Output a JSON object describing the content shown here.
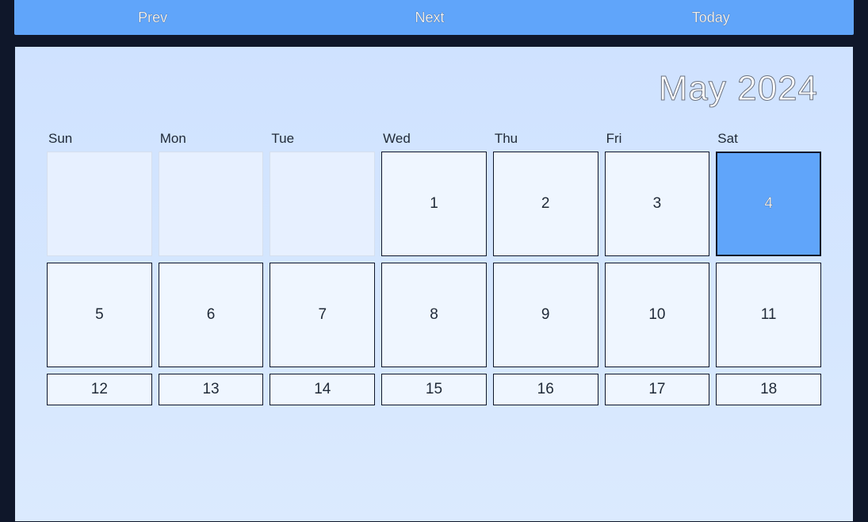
{
  "nav": {
    "prev": "Prev",
    "next": "Next",
    "today": "Today"
  },
  "title": "May 2024",
  "weekdays": [
    "Sun",
    "Mon",
    "Tue",
    "Wed",
    "Thu",
    "Fri",
    "Sat"
  ],
  "weeks": [
    [
      {
        "day": "",
        "outside": true,
        "selected": false
      },
      {
        "day": "",
        "outside": true,
        "selected": false
      },
      {
        "day": "",
        "outside": true,
        "selected": false
      },
      {
        "day": "1",
        "outside": false,
        "selected": false
      },
      {
        "day": "2",
        "outside": false,
        "selected": false
      },
      {
        "day": "3",
        "outside": false,
        "selected": false
      },
      {
        "day": "4",
        "outside": false,
        "selected": true
      }
    ],
    [
      {
        "day": "5",
        "outside": false,
        "selected": false
      },
      {
        "day": "6",
        "outside": false,
        "selected": false
      },
      {
        "day": "7",
        "outside": false,
        "selected": false
      },
      {
        "day": "8",
        "outside": false,
        "selected": false
      },
      {
        "day": "9",
        "outside": false,
        "selected": false
      },
      {
        "day": "10",
        "outside": false,
        "selected": false
      },
      {
        "day": "11",
        "outside": false,
        "selected": false
      }
    ],
    [
      {
        "day": "12",
        "outside": false,
        "selected": false
      },
      {
        "day": "13",
        "outside": false,
        "selected": false
      },
      {
        "day": "14",
        "outside": false,
        "selected": false
      },
      {
        "day": "15",
        "outside": false,
        "selected": false
      },
      {
        "day": "16",
        "outside": false,
        "selected": false
      },
      {
        "day": "17",
        "outside": false,
        "selected": false
      },
      {
        "day": "18",
        "outside": false,
        "selected": false
      }
    ]
  ]
}
